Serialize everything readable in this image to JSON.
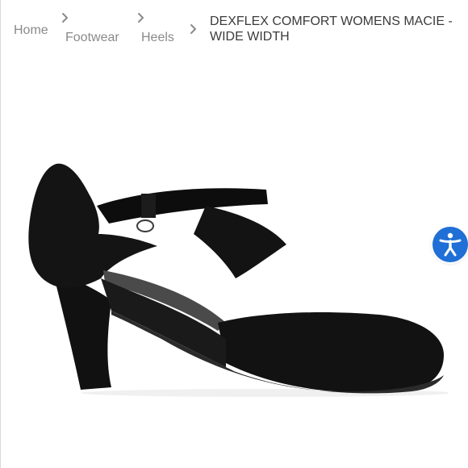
{
  "breadcrumb": {
    "items": [
      {
        "label": "Home"
      },
      {
        "label": "Footwear"
      },
      {
        "label": "Heels"
      }
    ],
    "current": "DEXFLEX COMFORT WOMENS MACIE - WIDE WIDTH"
  },
  "icons": {
    "separator": "chevron-right-icon",
    "accessibility": "accessibility-icon"
  },
  "colors": {
    "breadcrumb_text": "#8a8a8a",
    "title_text": "#3b3b3b",
    "accessibility_button": "#1f6fd6"
  }
}
